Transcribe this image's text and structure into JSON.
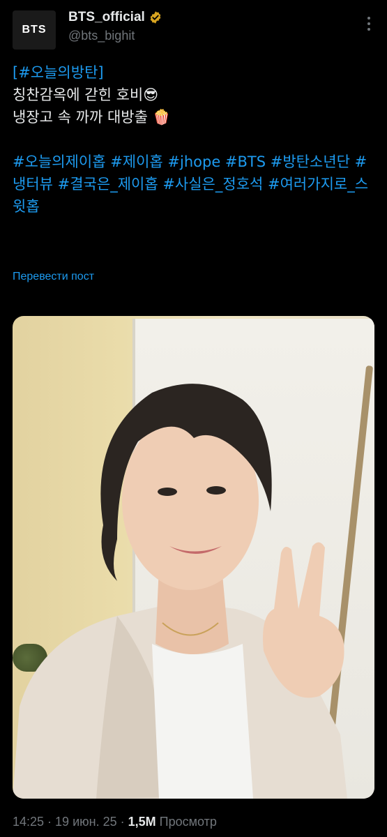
{
  "account": {
    "avatar_text": "BTS",
    "display_name": "BTS_official",
    "handle": "@bts_bighit",
    "verified_color": "#d9a520"
  },
  "tweet": {
    "line1_link": "[#오늘의방탄]",
    "line2": "칭찬감옥에 갇힌 호비😎",
    "line3": "냉장고 속 까까 대방출 🍿",
    "hashtags": "#오늘의제이홉 #제이홉 #jhope #BTS #방탄소년단 #냉터뷰 #결국은_제이홉 #사실은_정호석 #여러가지로_스윗홉",
    "translate_label": "Перевести пост"
  },
  "meta": {
    "time": "14:25",
    "date": "19 июн. 25",
    "views": "1,5M",
    "views_label": "Просмотр"
  },
  "colors": {
    "link": "#1d9bf0",
    "secondary": "#71767b",
    "background": "#000000"
  }
}
